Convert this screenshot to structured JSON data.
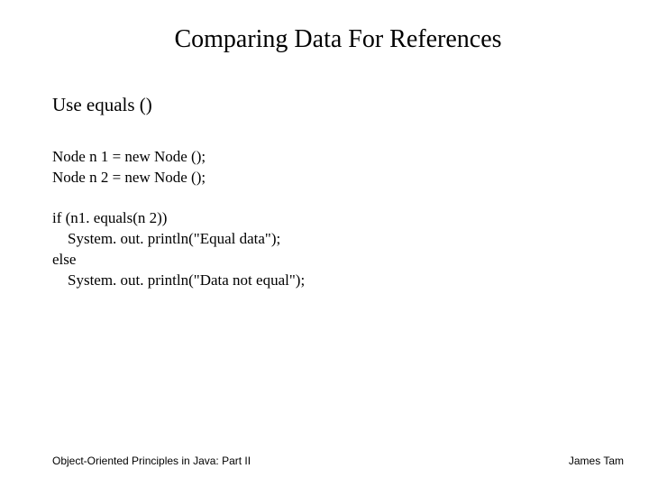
{
  "title": "Comparing Data For References",
  "subtitle": "Use equals ()",
  "code": {
    "l1": "Node n 1 = new Node ();",
    "l2": "Node n 2 = new Node ();",
    "l3": "if (n1. equals(n 2))",
    "l4": "    System. out. println(\"Equal data\");",
    "l5": "else",
    "l6": "    System. out. println(\"Data not equal\");"
  },
  "footer": {
    "left": "Object-Oriented Principles in Java: Part II",
    "right": "James Tam"
  }
}
